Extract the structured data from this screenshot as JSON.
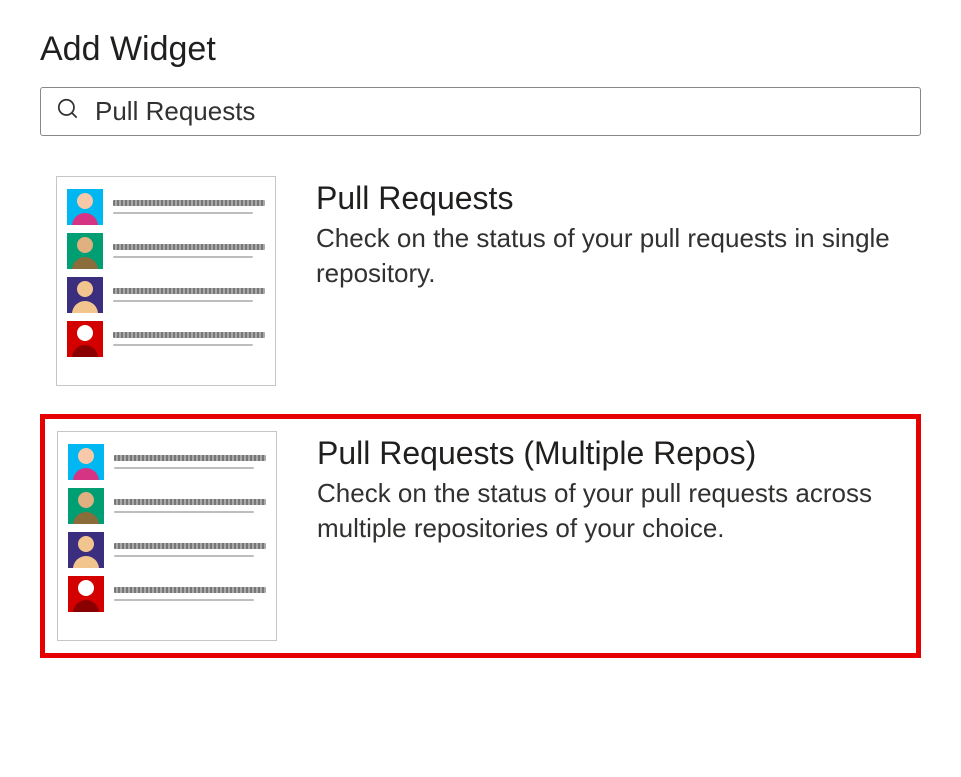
{
  "header": {
    "title": "Add Widget"
  },
  "search": {
    "value": "Pull Requests"
  },
  "widgets": [
    {
      "title": "Pull Requests",
      "description": "Check on the status of your pull requests in single repository.",
      "highlighted": false
    },
    {
      "title": "Pull Requests (Multiple Repos)",
      "description": "Check on the status of your pull requests across multiple repositories of your choice.",
      "highlighted": true
    }
  ],
  "thumbnail_avatars": [
    {
      "bg": "#00b7f1",
      "head": "#f7c9a8",
      "body": "#d63384",
      "accent": "#e6007a"
    },
    {
      "bg": "#009e73",
      "head": "#e0b080",
      "body": "#8a6d3b",
      "accent": "#6b4a1f"
    },
    {
      "bg": "#3b2e7e",
      "head": "#f2c58f",
      "body": "#f2c58f",
      "accent": "#f2c58f"
    },
    {
      "bg": "#d40000",
      "head": "#ffffff",
      "body": "#8a0000",
      "accent": "#ffffff"
    }
  ]
}
